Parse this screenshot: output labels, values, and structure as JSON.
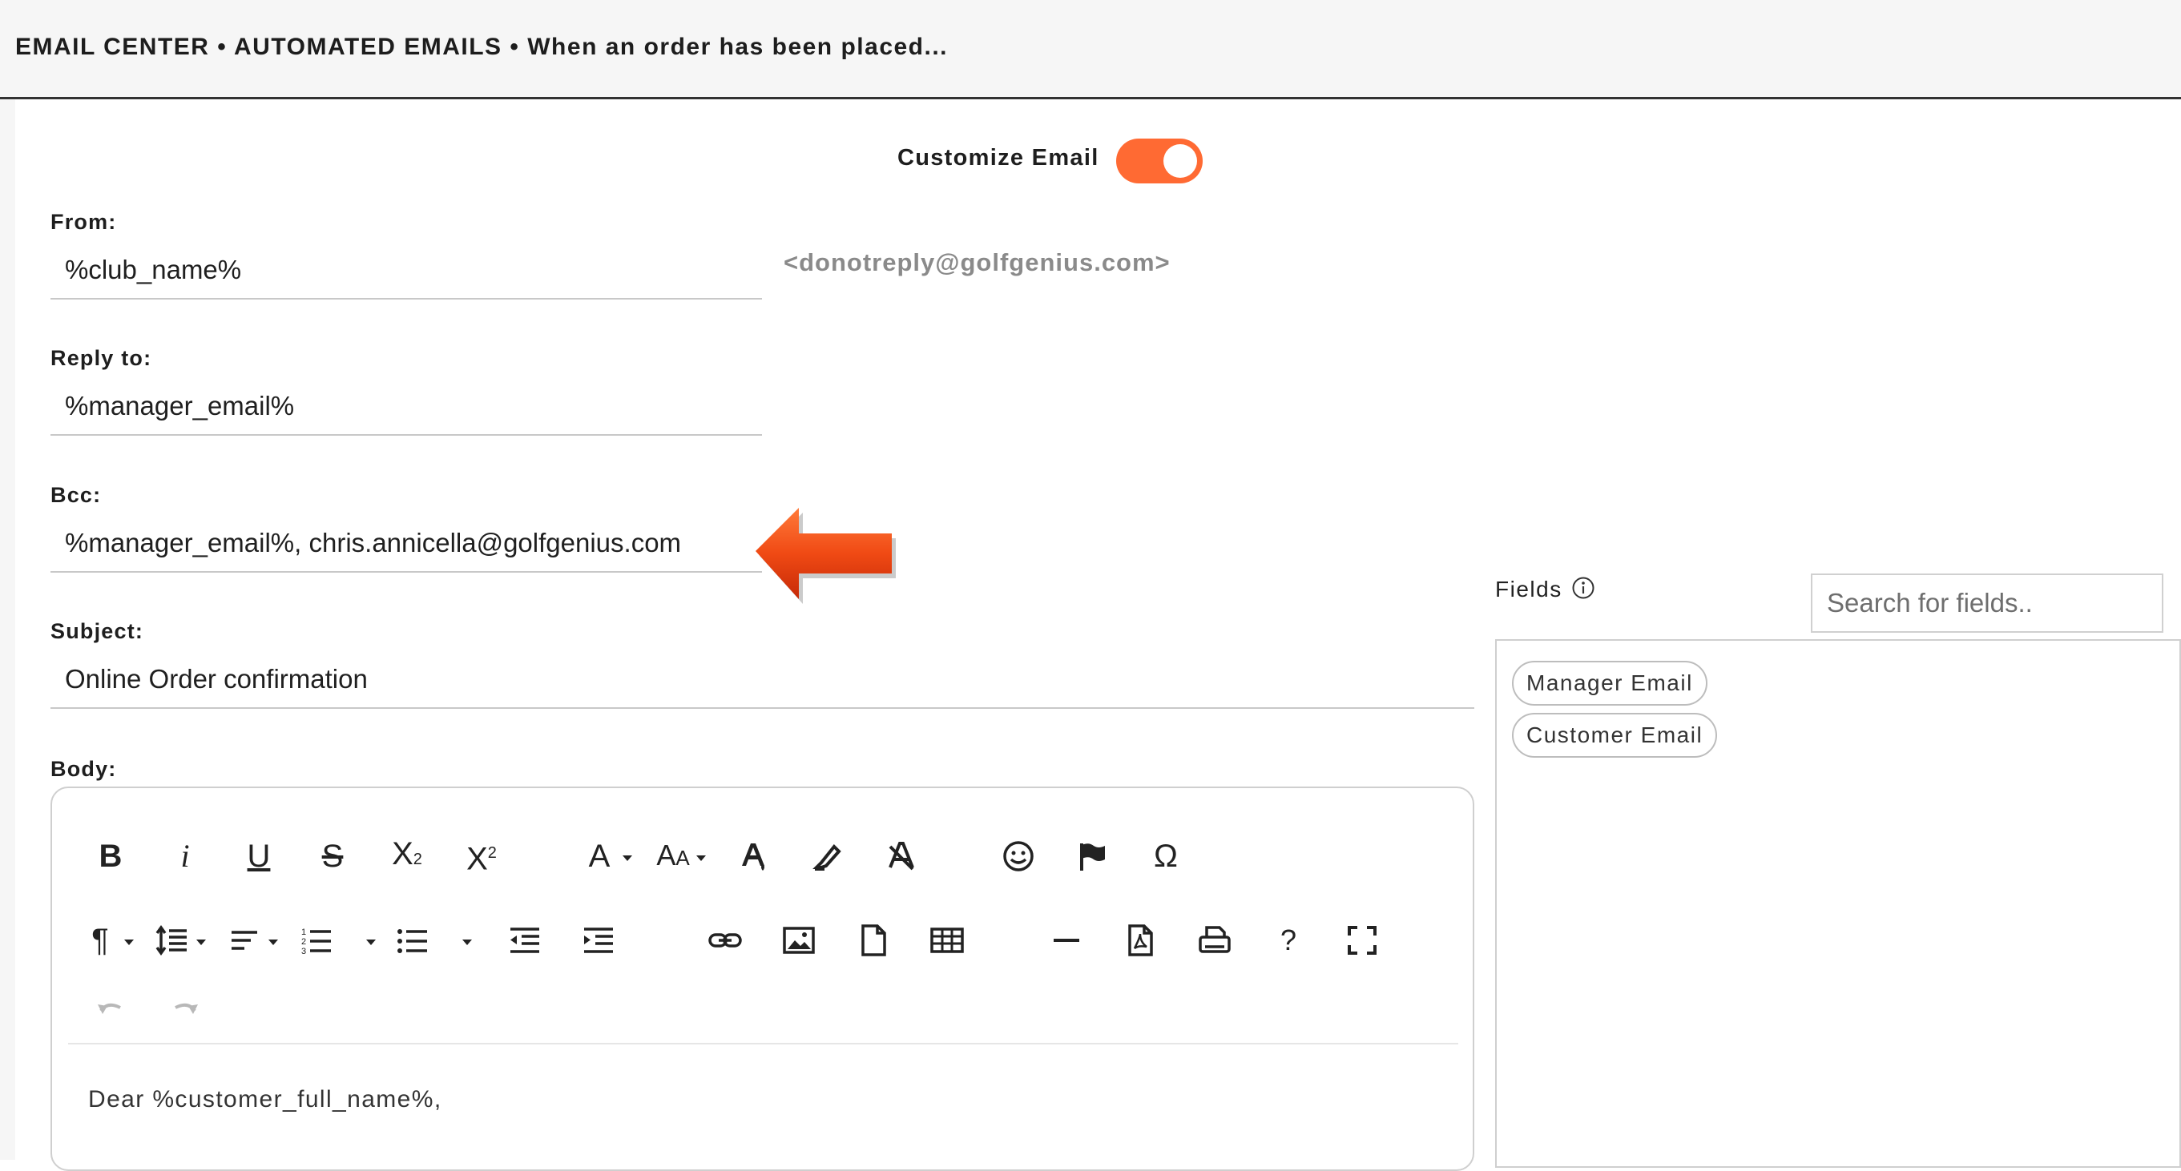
{
  "header": {
    "breadcrumb": "EMAIL CENTER • AUTOMATED EMAILS • When an order has been placed..."
  },
  "customize": {
    "label": "Customize Email",
    "enabled": true
  },
  "form": {
    "from_label": "From:",
    "from_value": "%club_name%",
    "from_email": "<donotreply@golfgenius.com>",
    "reply_to_label": "Reply to:",
    "reply_to_value": "%manager_email%",
    "bcc_label": "Bcc:",
    "bcc_value": "%manager_email%, chris.annicella@golfgenius.com",
    "subject_label": "Subject:",
    "subject_value": "Online Order confirmation",
    "body_label": "Body:"
  },
  "editor": {
    "body_text": "Dear %customer_full_name%,",
    "toolbar_row1": [
      "bold-icon",
      "italic-icon",
      "underline-icon",
      "strikethrough-icon",
      "subscript-icon",
      "superscript-icon",
      "font-family-icon",
      "font-size-icon",
      "text-color-icon",
      "background-color-icon",
      "clear-formatting-icon",
      "emoticons-icon",
      "special-flag-icon",
      "special-characters-icon"
    ],
    "toolbar_row2": [
      "paragraph-format-icon",
      "line-height-icon",
      "align-icon",
      "ordered-list-icon",
      "unordered-list-icon",
      "outdent-icon",
      "indent-icon",
      "link-icon",
      "image-icon",
      "file-icon",
      "table-icon",
      "horizontal-line-icon",
      "pdf-icon",
      "print-icon",
      "help-icon",
      "fullscreen-icon"
    ],
    "toolbar_row3": [
      "undo-icon",
      "redo-icon"
    ]
  },
  "fields_panel": {
    "label": "Fields",
    "search_placeholder": "Search for fields..",
    "chips": [
      "Manager Email",
      "Customer Email"
    ]
  },
  "colors": {
    "accent": "#ff6a33",
    "arrow": "#e8380e"
  }
}
